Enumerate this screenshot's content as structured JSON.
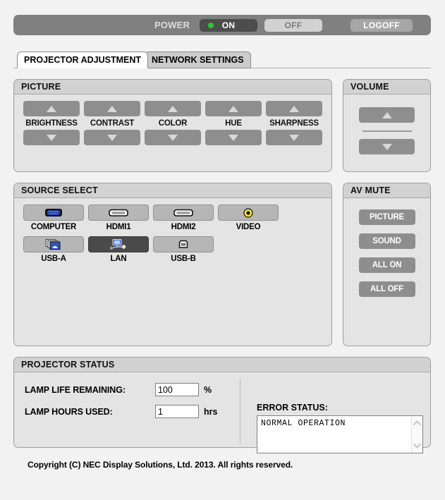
{
  "power_bar": {
    "label": "POWER",
    "on_label": "ON",
    "off_label": "OFF",
    "logoff_label": "LOGOFF",
    "led_color": "#22cc22",
    "active": "ON"
  },
  "tabs": [
    {
      "label": "PROJECTOR ADJUSTMENT",
      "active": true
    },
    {
      "label": "NETWORK SETTINGS",
      "active": false
    }
  ],
  "picture": {
    "title": "PICTURE",
    "controls": [
      {
        "label": "BRIGHTNESS",
        "up_icon": "triangle-up-icon",
        "down_icon": "triangle-down-icon"
      },
      {
        "label": "CONTRAST",
        "up_icon": "triangle-up-icon",
        "down_icon": "triangle-down-icon"
      },
      {
        "label": "COLOR",
        "up_icon": "triangle-up-icon",
        "down_icon": "triangle-down-icon"
      },
      {
        "label": "HUE",
        "up_icon": "triangle-up-icon",
        "down_icon": "triangle-down-icon"
      },
      {
        "label": "SHARPNESS",
        "up_icon": "triangle-up-icon",
        "down_icon": "triangle-down-icon"
      }
    ]
  },
  "volume": {
    "title": "VOLUME",
    "up_icon": "triangle-up-icon",
    "down_icon": "triangle-down-icon"
  },
  "source_select": {
    "title": "SOURCE SELECT",
    "selected": "LAN",
    "sources": [
      {
        "label": "COMPUTER",
        "icon": "vga-connector-icon",
        "selected": false
      },
      {
        "label": "HDMI1",
        "icon": "hdmi-connector-icon",
        "selected": false
      },
      {
        "label": "HDMI2",
        "icon": "hdmi-connector-icon",
        "selected": false
      },
      {
        "label": "VIDEO",
        "icon": "rca-jack-icon",
        "selected": false
      },
      {
        "label": "USB-A",
        "icon": "slide-stack-icon",
        "selected": false
      },
      {
        "label": "LAN",
        "icon": "network-icon",
        "selected": true
      },
      {
        "label": "USB-B",
        "icon": "usb-b-connector-icon",
        "selected": false
      }
    ]
  },
  "av_mute": {
    "title": "AV MUTE",
    "buttons": [
      {
        "label": "PICTURE"
      },
      {
        "label": "SOUND"
      },
      {
        "label": "ALL ON"
      },
      {
        "label": "ALL OFF"
      }
    ]
  },
  "projector_status": {
    "title": "PROJECTOR STATUS",
    "lamp_life_label": "LAMP LIFE REMAINING:",
    "lamp_life_value": "100",
    "lamp_life_unit": "%",
    "lamp_hours_label": "LAMP HOURS USED:",
    "lamp_hours_value": "1",
    "lamp_hours_unit": "hrs",
    "error_status_label": "ERROR STATUS:",
    "error_status_text": "NORMAL OPERATION"
  },
  "footer": {
    "copyright": "Copyright (C) NEC Display Solutions, Ltd. 2013. All rights reserved."
  }
}
